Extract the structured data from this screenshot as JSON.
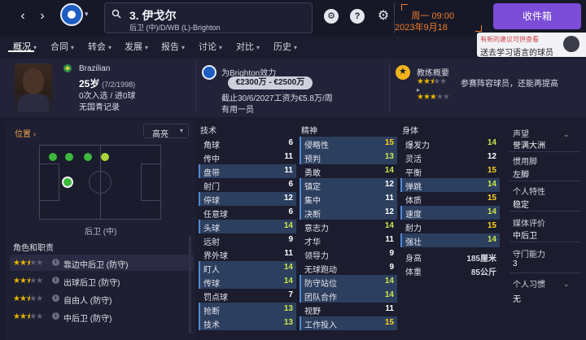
{
  "header": {
    "player_title": "3. 伊戈尔",
    "player_positions": "后卫 (中)/D/WB (L)-Brighton",
    "date_day": "周一 09:00",
    "date_full": "2023年9月18日",
    "inbox_label": "收件箱",
    "help_label": "?"
  },
  "tabs": [
    {
      "label": "概况",
      "dropdown": true
    },
    {
      "label": "合同",
      "dropdown": true
    },
    {
      "label": "转会",
      "dropdown": true
    },
    {
      "label": "发展",
      "dropdown": true
    },
    {
      "label": "报告",
      "dropdown": true
    },
    {
      "label": "讨论",
      "dropdown": true
    },
    {
      "label": "对比",
      "dropdown": true
    },
    {
      "label": "历史",
      "dropdown": true
    }
  ],
  "notification": {
    "line1": "有新的建议可供查看",
    "line2": "送去学习语言的球员"
  },
  "profile": {
    "nationality": "Brazilian",
    "age": "25岁",
    "dob": "(7/2/1998)",
    "caps": "0次入选 / 进0球",
    "youth": "无国青记录",
    "club_line": "为Brighton效力",
    "wage": "€2300万 - €2500万",
    "contract": "截止30/6/2027工资为€5.8万/周",
    "squad_status": "有用一员",
    "coach_title": "教练概要",
    "coach_text": "参赛阵容球员，还能再提高",
    "ability_stars": 2.5,
    "potential_stars": 3
  },
  "position_panel": {
    "title": "位置",
    "dropdown_label": "高亮",
    "current_position": "后卫 (中)",
    "roles_title": "角色和职责",
    "roles": [
      {
        "label": "靠边中后卫 (防守)",
        "stars": 2.5,
        "selected": true
      },
      {
        "label": "出球后卫 (防守)",
        "stars": 2.5,
        "selected": false
      },
      {
        "label": "自由人 (防守)",
        "stars": 2.5,
        "selected": false
      },
      {
        "label": "中后卫 (防守)",
        "stars": 2.5,
        "selected": false
      }
    ]
  },
  "attributes": {
    "technical_title": "技术",
    "mental_title": "精神",
    "physical_title": "身体",
    "technical": [
      {
        "name": "角球",
        "value": "6",
        "hl": false
      },
      {
        "name": "传中",
        "value": "11",
        "hl": false
      },
      {
        "name": "盘带",
        "value": "11",
        "hl": true
      },
      {
        "name": "射门",
        "value": "6",
        "hl": false
      },
      {
        "name": "停球",
        "value": "12",
        "hl": true
      },
      {
        "name": "任意球",
        "value": "6",
        "hl": false
      },
      {
        "name": "头球",
        "value": "14",
        "hl": true
      },
      {
        "name": "远射",
        "value": "9",
        "hl": false
      },
      {
        "name": "界外球",
        "value": "11",
        "hl": false
      },
      {
        "name": "盯人",
        "value": "14",
        "hl": true
      },
      {
        "name": "传球",
        "value": "14",
        "hl": true
      },
      {
        "name": "罚点球",
        "value": "7",
        "hl": false
      },
      {
        "name": "抢断",
        "value": "13",
        "hl": true
      },
      {
        "name": "技术",
        "value": "13",
        "hl": true
      }
    ],
    "mental": [
      {
        "name": "侵略性",
        "value": "15",
        "hl": true
      },
      {
        "name": "预判",
        "value": "13",
        "hl": true
      },
      {
        "name": "勇敢",
        "value": "14",
        "hl": false
      },
      {
        "name": "镇定",
        "value": "12",
        "hl": true
      },
      {
        "name": "集中",
        "value": "11",
        "hl": true
      },
      {
        "name": "决断",
        "value": "12",
        "hl": true
      },
      {
        "name": "意志力",
        "value": "14",
        "hl": false
      },
      {
        "name": "才华",
        "value": "11",
        "hl": false
      },
      {
        "name": "领导力",
        "value": "9",
        "hl": false
      },
      {
        "name": "无球跑动",
        "value": "9",
        "hl": false
      },
      {
        "name": "防守站位",
        "value": "14",
        "hl": true
      },
      {
        "name": "团队合作",
        "value": "14",
        "hl": true
      },
      {
        "name": "视野",
        "value": "11",
        "hl": false
      },
      {
        "name": "工作投入",
        "value": "15",
        "hl": true
      }
    ],
    "physical": [
      {
        "name": "爆发力",
        "value": "14",
        "hl": false
      },
      {
        "name": "灵活",
        "value": "12",
        "hl": false
      },
      {
        "name": "平衡",
        "value": "15",
        "hl": false
      },
      {
        "name": "弹跳",
        "value": "14",
        "hl": true
      },
      {
        "name": "体质",
        "value": "15",
        "hl": false
      },
      {
        "name": "速度",
        "value": "14",
        "hl": true
      },
      {
        "name": "耐力",
        "value": "15",
        "hl": false
      },
      {
        "name": "强壮",
        "value": "14",
        "hl": true
      }
    ],
    "height_label": "身高",
    "height_value": "185厘米",
    "weight_label": "体重",
    "weight_value": "85公斤"
  },
  "side_info": {
    "rep_label": "声望",
    "rep_value": "誉满大洲",
    "foot_label": "惯用脚",
    "foot_value": "左脚",
    "personality_label": "个人特性",
    "personality_value": "稳定",
    "media_label": "媒体评价",
    "media_value": "中后卫",
    "gk_label": "守门能力",
    "gk_value": "3",
    "habits_label": "个人习惯",
    "habits_value": "无"
  },
  "colors": {
    "accent": "#7a4cd8",
    "date": "#f07d2c",
    "value_high": "#ffd21f",
    "value_mid": "#cde74b",
    "value_low": "#ffffff",
    "highlight_row": "#2c3f5e",
    "star": "#e6b400"
  }
}
